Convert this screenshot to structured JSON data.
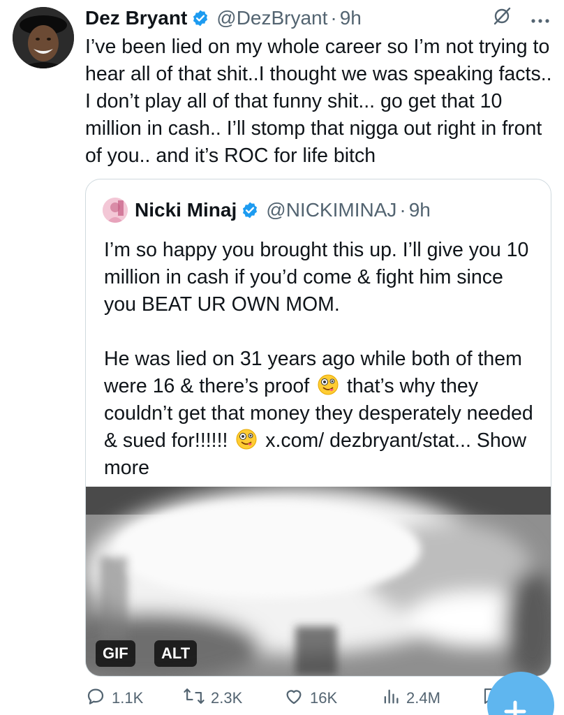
{
  "author": {
    "name": "Dez Bryant",
    "handle": "@DezBryant",
    "separator": "·",
    "time": "9h"
  },
  "tweet_text": "I’ve been lied on my whole career so I’m not trying to hear all of that shit..I thought we was speaking facts.. I don’t play all of that funny shit... go get that 10 million in cash.. I’ll stomp that nigga out right in front of you.. and it’s ROC for life bitch",
  "quoted": {
    "name": "Nicki Minaj",
    "handle": "@NICKIMINAJ",
    "separator": "·",
    "time": "9h",
    "paragraph1": "I’m so happy you brought this up. I’ll give you 10 million in cash if you’d come & fight him since you BEAT UR OWN MOM.",
    "p2_part1": "He was lied on 31 years ago while both of them were 16 & there’s proof",
    "p2_part2": "that’s why they couldn’t get that money they desperately needed & sued for!!!!!!",
    "p2_part3": "x.com/ dezbryant/stat...",
    "show_more": "Show more",
    "emoji": "zany-face",
    "media_badges": {
      "gif": "GIF",
      "alt": "ALT"
    }
  },
  "actions": {
    "replies": "1.1K",
    "reposts": "2.3K",
    "likes": "16K",
    "views": "2.4M"
  },
  "icons": {
    "verified": "verified-badge-icon",
    "grok": "grok-icon",
    "more": "more-icon",
    "reply": "reply-icon",
    "repost": "repost-icon",
    "like": "like-icon",
    "views": "views-icon",
    "bookmark": "bookmark-icon",
    "share": "share-icon",
    "compose": "compose-fab"
  },
  "colors": {
    "text": "#0f1419",
    "secondary": "#536471",
    "verified": "#1d9bf0",
    "border": "#cfd9de",
    "fab": "#5fb6ef"
  }
}
